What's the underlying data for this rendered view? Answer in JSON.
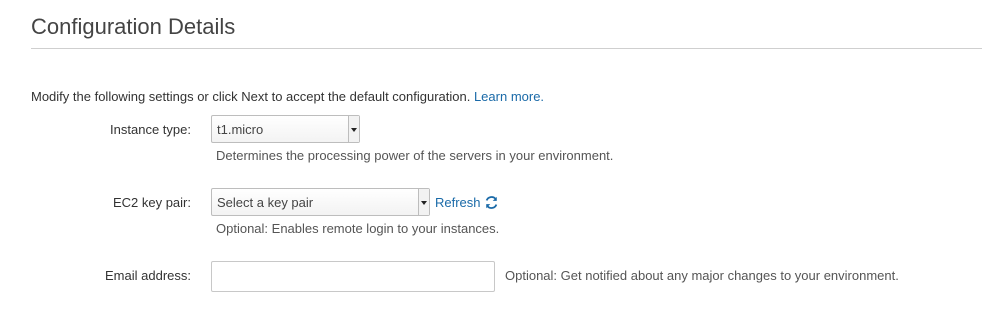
{
  "section": {
    "title": "Configuration Details"
  },
  "intro": {
    "text": "Modify the following settings or click Next to accept the default configuration. ",
    "learn_more": "Learn more."
  },
  "instance_type": {
    "label": "Instance type:",
    "value": "t1.micro",
    "help": "Determines the processing power of the servers in your environment."
  },
  "key_pair": {
    "label": "EC2 key pair:",
    "value": "Select a key pair",
    "refresh": "Refresh",
    "refresh_icon": "refresh-icon",
    "help": "Optional: Enables remote login to your instances."
  },
  "email": {
    "label": "Email address:",
    "value": "",
    "placeholder": "",
    "help": "Optional: Get notified about any major changes to your environment."
  },
  "colors": {
    "link": "#1a6aa8",
    "text": "#333333"
  }
}
